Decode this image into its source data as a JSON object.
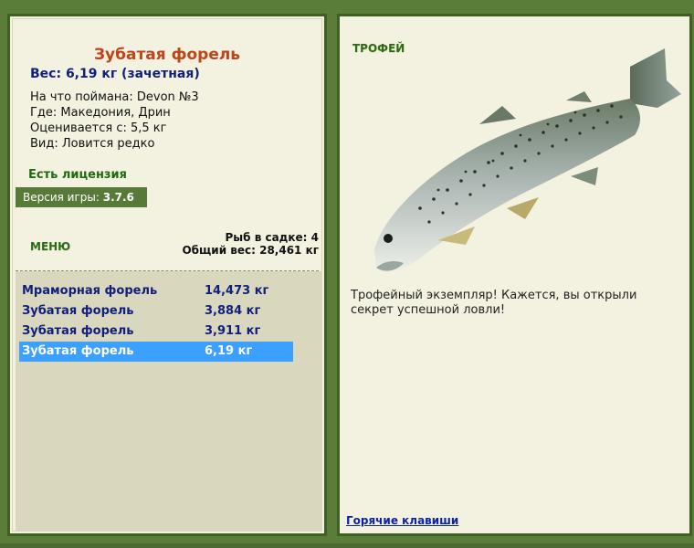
{
  "left_panel": {
    "fish_name": "Зубатая форель",
    "weight_line": "Вес: 6,19 кг (зачетная)",
    "info": [
      "На что поймана: Devon №3",
      "Где: Македония, Дрин",
      "Оценивается с: 5,5 кг",
      "Вид: Ловится редко"
    ],
    "license": "Есть лицензия",
    "version_label": "Версия игры:",
    "version_value": "3.7.6",
    "menu_label": "МЕНЮ",
    "cage_count": "Рыб в садке: 4",
    "total_weight": "Общий вес: 28,461 кг",
    "catch": [
      {
        "name": "Мраморная форель",
        "weight": "14,473 кг"
      },
      {
        "name": "Зубатая форель",
        "weight": "3,884 кг"
      },
      {
        "name": "Зубатая форель",
        "weight": "3,911 кг"
      },
      {
        "name": "Зубатая форель",
        "weight": "6,19 кг"
      }
    ]
  },
  "right_panel": {
    "trophy_label": "ТРОФЕЙ",
    "trophy_text": "Трофейный экземпляр! Кажется, вы открыли секрет успешной ловли!",
    "hotkeys_link": "Горячие клавиши"
  },
  "colors": {
    "background": "#5a7d3a",
    "panel": "#f3f1e0",
    "title": "#c0441a",
    "selected_row": "#3ba0ff"
  }
}
